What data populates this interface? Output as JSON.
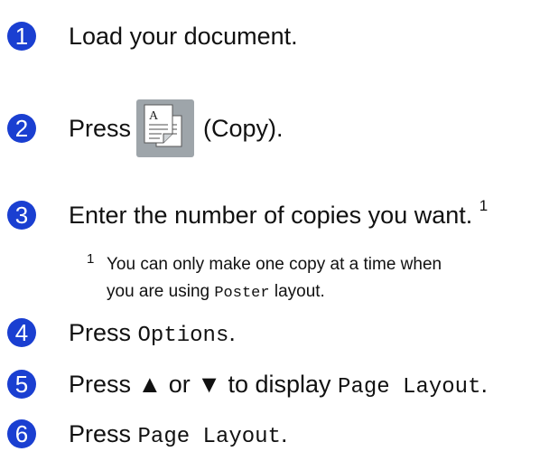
{
  "steps": [
    {
      "n": "1",
      "text": "Load your document."
    },
    {
      "n": "2",
      "before": "Press",
      "after": "(Copy)."
    },
    {
      "n": "3",
      "text": "Enter the number of copies you want.",
      "footnote_mark": "1"
    },
    {
      "n": "4",
      "before": "Press ",
      "mono": "Options",
      "after": "."
    },
    {
      "n": "5",
      "before": "Press ▲ or ▼ to display ",
      "mono": "Page Layout",
      "after": "."
    },
    {
      "n": "6",
      "before": "Press ",
      "mono": "Page Layout",
      "after": "."
    }
  ],
  "footnote": {
    "mark": "1",
    "line1": "You can only make one copy at a time when",
    "line2_before": "you are using ",
    "line2_mono": "Poster",
    "line2_after": " layout."
  },
  "icon": {
    "name": "copy-icon",
    "letter": "A",
    "bg": "#9ea5aa"
  },
  "colors": {
    "step_circle": "#1a3fd1"
  }
}
